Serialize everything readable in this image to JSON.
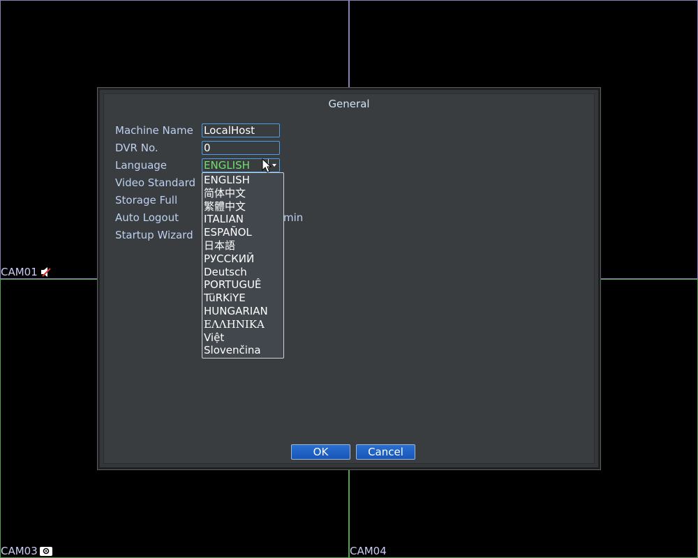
{
  "cameras": {
    "cam1": {
      "label": "CAM01"
    },
    "cam3": {
      "label": "CAM03"
    },
    "cam4": {
      "label": "CAM04"
    }
  },
  "dialog": {
    "title": "General",
    "fields": {
      "machine_name": {
        "label": "Machine Name",
        "value": "LocalHost"
      },
      "dvr_no": {
        "label": "DVR No.",
        "value": "0"
      },
      "language": {
        "label": "Language",
        "value": "ENGLISH"
      },
      "video_standard": {
        "label": "Video Standard"
      },
      "storage_full": {
        "label": "Storage Full"
      },
      "auto_logout": {
        "label": "Auto Logout",
        "unit": "min"
      },
      "startup_wizard": {
        "label": "Startup Wizard"
      }
    },
    "language_options": [
      "ENGLISH",
      "简体中文",
      "繁體中文",
      "ITALIAN",
      "ESPAÑOL",
      "日本語",
      "РУССКИЙ",
      "Deutsch",
      "PORTUGUÊ",
      "TüRKiYE",
      "HUNGARIAN",
      "ΕΛΛΗΝΙΚΑ",
      "Việt",
      "Slovenčina"
    ],
    "buttons": {
      "ok": "OK",
      "cancel": "Cancel"
    }
  },
  "colors": {
    "accent": "#4da0e8",
    "selected_value": "#6fe06f",
    "button": "#1f62c4"
  }
}
